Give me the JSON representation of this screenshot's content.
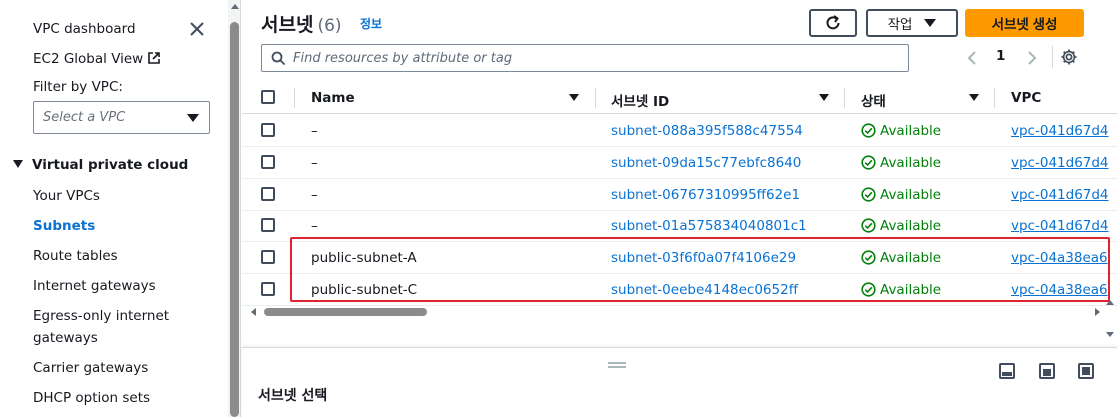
{
  "sidebar": {
    "dashboard": "VPC dashboard",
    "global_view": "EC2 Global View",
    "filter_label": "Filter by VPC:",
    "filter_placeholder": "Select a VPC",
    "section_title": "Virtual private cloud",
    "items": [
      {
        "label": "Your VPCs"
      },
      {
        "label": "Subnets"
      },
      {
        "label": "Route tables"
      },
      {
        "label": "Internet gateways"
      },
      {
        "label": "Egress-only internet"
      },
      {
        "label": "gateways"
      },
      {
        "label": "Carrier gateways"
      },
      {
        "label": "DHCP option sets"
      }
    ]
  },
  "header": {
    "title": "서브넷",
    "count": "(6)",
    "info": "정보",
    "actions_label": "작업",
    "create_label": "서브넷 생성"
  },
  "search": {
    "placeholder": "Find resources by attribute or tag"
  },
  "pagination": {
    "page": "1"
  },
  "table": {
    "columns": [
      "Name",
      "서브넷 ID",
      "상태",
      "VPC"
    ],
    "rows": [
      {
        "name": "–",
        "subnet_id": "subnet-088a395f588c47554",
        "status": "Available",
        "vpc": "vpc-041d67d4"
      },
      {
        "name": "–",
        "subnet_id": "subnet-09da15c77ebfc8640",
        "status": "Available",
        "vpc": "vpc-041d67d4"
      },
      {
        "name": "–",
        "subnet_id": "subnet-06767310995ff62e1",
        "status": "Available",
        "vpc": "vpc-041d67d4"
      },
      {
        "name": "–",
        "subnet_id": "subnet-01a575834040801c1",
        "status": "Available",
        "vpc": "vpc-041d67d4"
      },
      {
        "name": "public-subnet-A",
        "subnet_id": "subnet-03f6f0a07f4106e29",
        "status": "Available",
        "vpc": "vpc-04a38ea6"
      },
      {
        "name": "public-subnet-C",
        "subnet_id": "subnet-0eebe4148ec0652ff",
        "status": "Available",
        "vpc": "vpc-04a38ea6"
      }
    ]
  },
  "split_panel": {
    "title": "서브넷 선택"
  },
  "colors": {
    "accent": "#0972d3",
    "primary_button": "#ff9900",
    "status_ok": "#037f0c",
    "highlight": "#e0242f"
  }
}
